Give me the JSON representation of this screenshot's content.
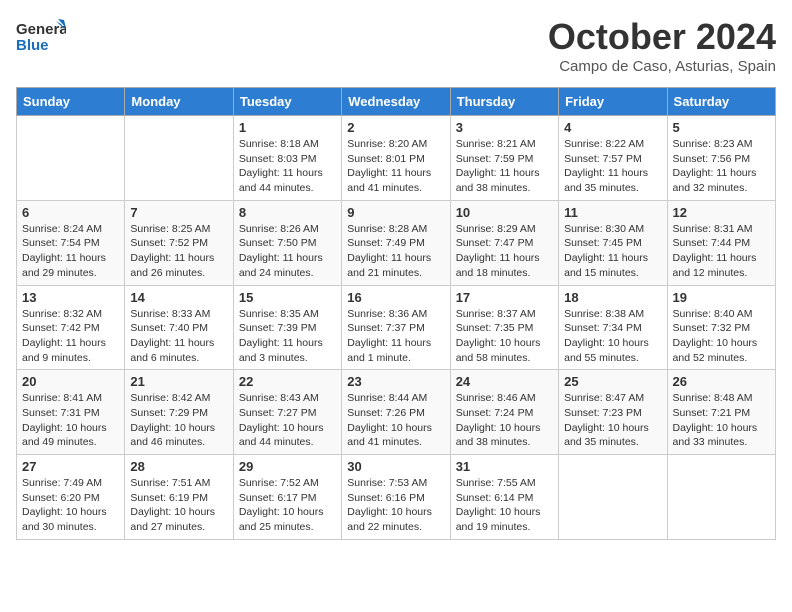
{
  "header": {
    "logo_general": "General",
    "logo_blue": "Blue",
    "month_year": "October 2024",
    "location": "Campo de Caso, Asturias, Spain"
  },
  "weekdays": [
    "Sunday",
    "Monday",
    "Tuesday",
    "Wednesday",
    "Thursday",
    "Friday",
    "Saturday"
  ],
  "weeks": [
    [
      {
        "day": "",
        "info": ""
      },
      {
        "day": "",
        "info": ""
      },
      {
        "day": "1",
        "info": "Sunrise: 8:18 AM\nSunset: 8:03 PM\nDaylight: 11 hours and 44 minutes."
      },
      {
        "day": "2",
        "info": "Sunrise: 8:20 AM\nSunset: 8:01 PM\nDaylight: 11 hours and 41 minutes."
      },
      {
        "day": "3",
        "info": "Sunrise: 8:21 AM\nSunset: 7:59 PM\nDaylight: 11 hours and 38 minutes."
      },
      {
        "day": "4",
        "info": "Sunrise: 8:22 AM\nSunset: 7:57 PM\nDaylight: 11 hours and 35 minutes."
      },
      {
        "day": "5",
        "info": "Sunrise: 8:23 AM\nSunset: 7:56 PM\nDaylight: 11 hours and 32 minutes."
      }
    ],
    [
      {
        "day": "6",
        "info": "Sunrise: 8:24 AM\nSunset: 7:54 PM\nDaylight: 11 hours and 29 minutes."
      },
      {
        "day": "7",
        "info": "Sunrise: 8:25 AM\nSunset: 7:52 PM\nDaylight: 11 hours and 26 minutes."
      },
      {
        "day": "8",
        "info": "Sunrise: 8:26 AM\nSunset: 7:50 PM\nDaylight: 11 hours and 24 minutes."
      },
      {
        "day": "9",
        "info": "Sunrise: 8:28 AM\nSunset: 7:49 PM\nDaylight: 11 hours and 21 minutes."
      },
      {
        "day": "10",
        "info": "Sunrise: 8:29 AM\nSunset: 7:47 PM\nDaylight: 11 hours and 18 minutes."
      },
      {
        "day": "11",
        "info": "Sunrise: 8:30 AM\nSunset: 7:45 PM\nDaylight: 11 hours and 15 minutes."
      },
      {
        "day": "12",
        "info": "Sunrise: 8:31 AM\nSunset: 7:44 PM\nDaylight: 11 hours and 12 minutes."
      }
    ],
    [
      {
        "day": "13",
        "info": "Sunrise: 8:32 AM\nSunset: 7:42 PM\nDaylight: 11 hours and 9 minutes."
      },
      {
        "day": "14",
        "info": "Sunrise: 8:33 AM\nSunset: 7:40 PM\nDaylight: 11 hours and 6 minutes."
      },
      {
        "day": "15",
        "info": "Sunrise: 8:35 AM\nSunset: 7:39 PM\nDaylight: 11 hours and 3 minutes."
      },
      {
        "day": "16",
        "info": "Sunrise: 8:36 AM\nSunset: 7:37 PM\nDaylight: 11 hours and 1 minute."
      },
      {
        "day": "17",
        "info": "Sunrise: 8:37 AM\nSunset: 7:35 PM\nDaylight: 10 hours and 58 minutes."
      },
      {
        "day": "18",
        "info": "Sunrise: 8:38 AM\nSunset: 7:34 PM\nDaylight: 10 hours and 55 minutes."
      },
      {
        "day": "19",
        "info": "Sunrise: 8:40 AM\nSunset: 7:32 PM\nDaylight: 10 hours and 52 minutes."
      }
    ],
    [
      {
        "day": "20",
        "info": "Sunrise: 8:41 AM\nSunset: 7:31 PM\nDaylight: 10 hours and 49 minutes."
      },
      {
        "day": "21",
        "info": "Sunrise: 8:42 AM\nSunset: 7:29 PM\nDaylight: 10 hours and 46 minutes."
      },
      {
        "day": "22",
        "info": "Sunrise: 8:43 AM\nSunset: 7:27 PM\nDaylight: 10 hours and 44 minutes."
      },
      {
        "day": "23",
        "info": "Sunrise: 8:44 AM\nSunset: 7:26 PM\nDaylight: 10 hours and 41 minutes."
      },
      {
        "day": "24",
        "info": "Sunrise: 8:46 AM\nSunset: 7:24 PM\nDaylight: 10 hours and 38 minutes."
      },
      {
        "day": "25",
        "info": "Sunrise: 8:47 AM\nSunset: 7:23 PM\nDaylight: 10 hours and 35 minutes."
      },
      {
        "day": "26",
        "info": "Sunrise: 8:48 AM\nSunset: 7:21 PM\nDaylight: 10 hours and 33 minutes."
      }
    ],
    [
      {
        "day": "27",
        "info": "Sunrise: 7:49 AM\nSunset: 6:20 PM\nDaylight: 10 hours and 30 minutes."
      },
      {
        "day": "28",
        "info": "Sunrise: 7:51 AM\nSunset: 6:19 PM\nDaylight: 10 hours and 27 minutes."
      },
      {
        "day": "29",
        "info": "Sunrise: 7:52 AM\nSunset: 6:17 PM\nDaylight: 10 hours and 25 minutes."
      },
      {
        "day": "30",
        "info": "Sunrise: 7:53 AM\nSunset: 6:16 PM\nDaylight: 10 hours and 22 minutes."
      },
      {
        "day": "31",
        "info": "Sunrise: 7:55 AM\nSunset: 6:14 PM\nDaylight: 10 hours and 19 minutes."
      },
      {
        "day": "",
        "info": ""
      },
      {
        "day": "",
        "info": ""
      }
    ]
  ]
}
